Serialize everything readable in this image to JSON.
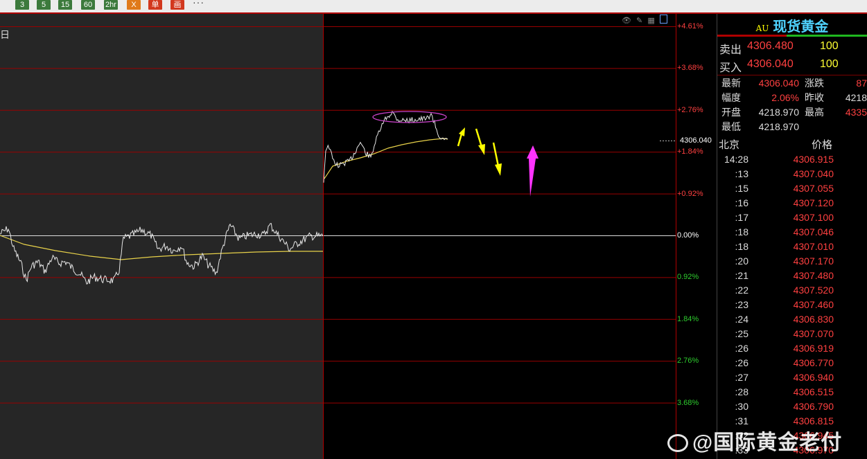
{
  "toolbar": {
    "buttons": [
      {
        "label": "3",
        "style": "green"
      },
      {
        "label": "5",
        "style": "green"
      },
      {
        "label": "15",
        "style": "green"
      },
      {
        "label": "60",
        "style": "green"
      },
      {
        "label": "2hr",
        "style": "green"
      },
      {
        "label": "X",
        "style": "orange"
      },
      {
        "label": "单",
        "style": "red"
      },
      {
        "label": "画",
        "style": "red"
      }
    ],
    "more": "···"
  },
  "chart": {
    "period_label": "日",
    "icons": [
      "eye-icon",
      "pencil-icon",
      "grid-icon",
      "window-icon"
    ],
    "axis_labels": [
      {
        "text": "+4.61%",
        "color": "#ff4040"
      },
      {
        "text": "+3.68%",
        "color": "#ff4040"
      },
      {
        "text": "+2.76%",
        "color": "#ff4040"
      },
      {
        "text": "+1.84%",
        "color": "#ff4040"
      },
      {
        "text": "+0.92%",
        "color": "#ff4040"
      },
      {
        "text": "0.00%",
        "color": "#ffffff"
      },
      {
        "text": "0.92%",
        "color": "#2ecc2e"
      },
      {
        "text": "1.84%",
        "color": "#2ecc2e"
      },
      {
        "text": "2.76%",
        "color": "#2ecc2e"
      },
      {
        "text": "3.68%",
        "color": "#2ecc2e"
      }
    ],
    "current_price_tag": "4306.040",
    "annotation_colors": {
      "arrow_yellow": "#ffff00",
      "arrow_magenta": "#ff33ff",
      "ellipse": "#cc44cc"
    }
  },
  "panel": {
    "symbol_code": "AU",
    "symbol_name": "现货黄金",
    "sell": {
      "label": "卖出",
      "price": "4306.480",
      "qty": "100"
    },
    "buy": {
      "label": "买入",
      "price": "4306.040",
      "qty": "100"
    },
    "stats": {
      "latest_label": "最新",
      "latest": "4306.040",
      "change_label": "涨跌",
      "change": "87",
      "pct_label": "幅度",
      "pct": "2.06%",
      "prev_close_label": "昨收",
      "prev_close": "4218",
      "open_label": "开盘",
      "open": "4218.970",
      "high_label": "最高",
      "high": "4335",
      "low_label": "最低",
      "low": "4218.970"
    },
    "ticks_header": {
      "time": "北京",
      "price": "价格"
    },
    "ticks": [
      {
        "time": "14:28",
        "price": "4306.915"
      },
      {
        "time": ":13",
        "price": "4307.040"
      },
      {
        "time": ":15",
        "price": "4307.055"
      },
      {
        "time": ":16",
        "price": "4307.120"
      },
      {
        "time": ":17",
        "price": "4307.100"
      },
      {
        "time": ":18",
        "price": "4307.046"
      },
      {
        "time": ":18",
        "price": "4307.010"
      },
      {
        "time": ":20",
        "price": "4307.170"
      },
      {
        "time": ":21",
        "price": "4307.480"
      },
      {
        "time": ":22",
        "price": "4307.520"
      },
      {
        "time": ":23",
        "price": "4307.460"
      },
      {
        "time": ":24",
        "price": "4306.830"
      },
      {
        "time": ":25",
        "price": "4307.070"
      },
      {
        "time": ":26",
        "price": "4306.919"
      },
      {
        "time": ":26",
        "price": "4306.770"
      },
      {
        "time": ":27",
        "price": "4306.940"
      },
      {
        "time": ":28",
        "price": "4306.515"
      },
      {
        "time": ":30",
        "price": "4306.790"
      },
      {
        "time": ":31",
        "price": "4306.815"
      },
      {
        "time": ":32",
        "price": "4306.945"
      },
      {
        "time": ":33",
        "price": "4306.970"
      }
    ]
  },
  "watermark": "@国际黄金老付"
}
